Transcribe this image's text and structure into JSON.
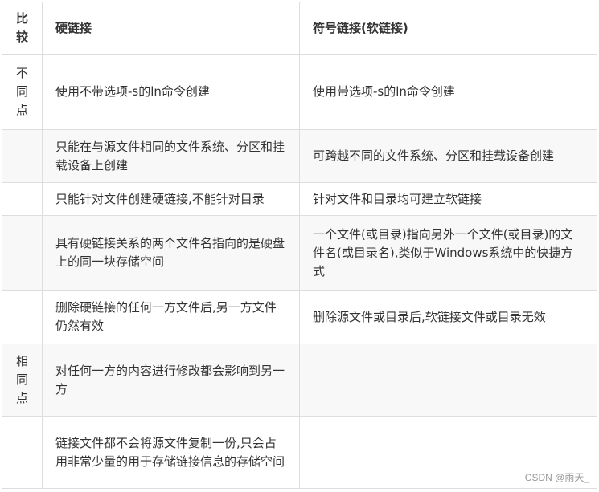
{
  "table": {
    "header": {
      "compare": "比较",
      "hard_link": "硬链接",
      "soft_link": "符号链接(软链接)"
    },
    "groups": {
      "different": "不同点",
      "same": "相同点"
    },
    "rows": [
      {
        "hard": "使用不带选项-s的ln命令创建",
        "soft": "使用带选项-s的ln命令创建"
      },
      {
        "hard": "只能在与源文件相同的文件系统、分区和挂载设备上创建",
        "soft": "可跨越不同的文件系统、分区和挂载设备创建"
      },
      {
        "hard": "只能针对文件创建硬链接,不能针对目录",
        "soft": "针对文件和目录均可建立软链接"
      },
      {
        "hard": "具有硬链接关系的两个文件名指向的是硬盘上的同一块存储空间",
        "soft": "一个文件(或目录)指向另外一个文件(或目录)的文件名(或目录名),类似于Windows系统中的快捷方式"
      },
      {
        "hard": "删除硬链接的任何一方文件后,另一方文件仍然有效",
        "soft": "删除源文件或目录后,软链接文件或目录无效"
      },
      {
        "hard": "对任何一方的内容进行修改都会影响到另一方",
        "soft": ""
      },
      {
        "hard": "链接文件都不会将源文件复制一份,只会占用非常少量的用于存储链接信息的存储空间",
        "soft": ""
      }
    ]
  },
  "watermark": "CSDN @雨天_"
}
